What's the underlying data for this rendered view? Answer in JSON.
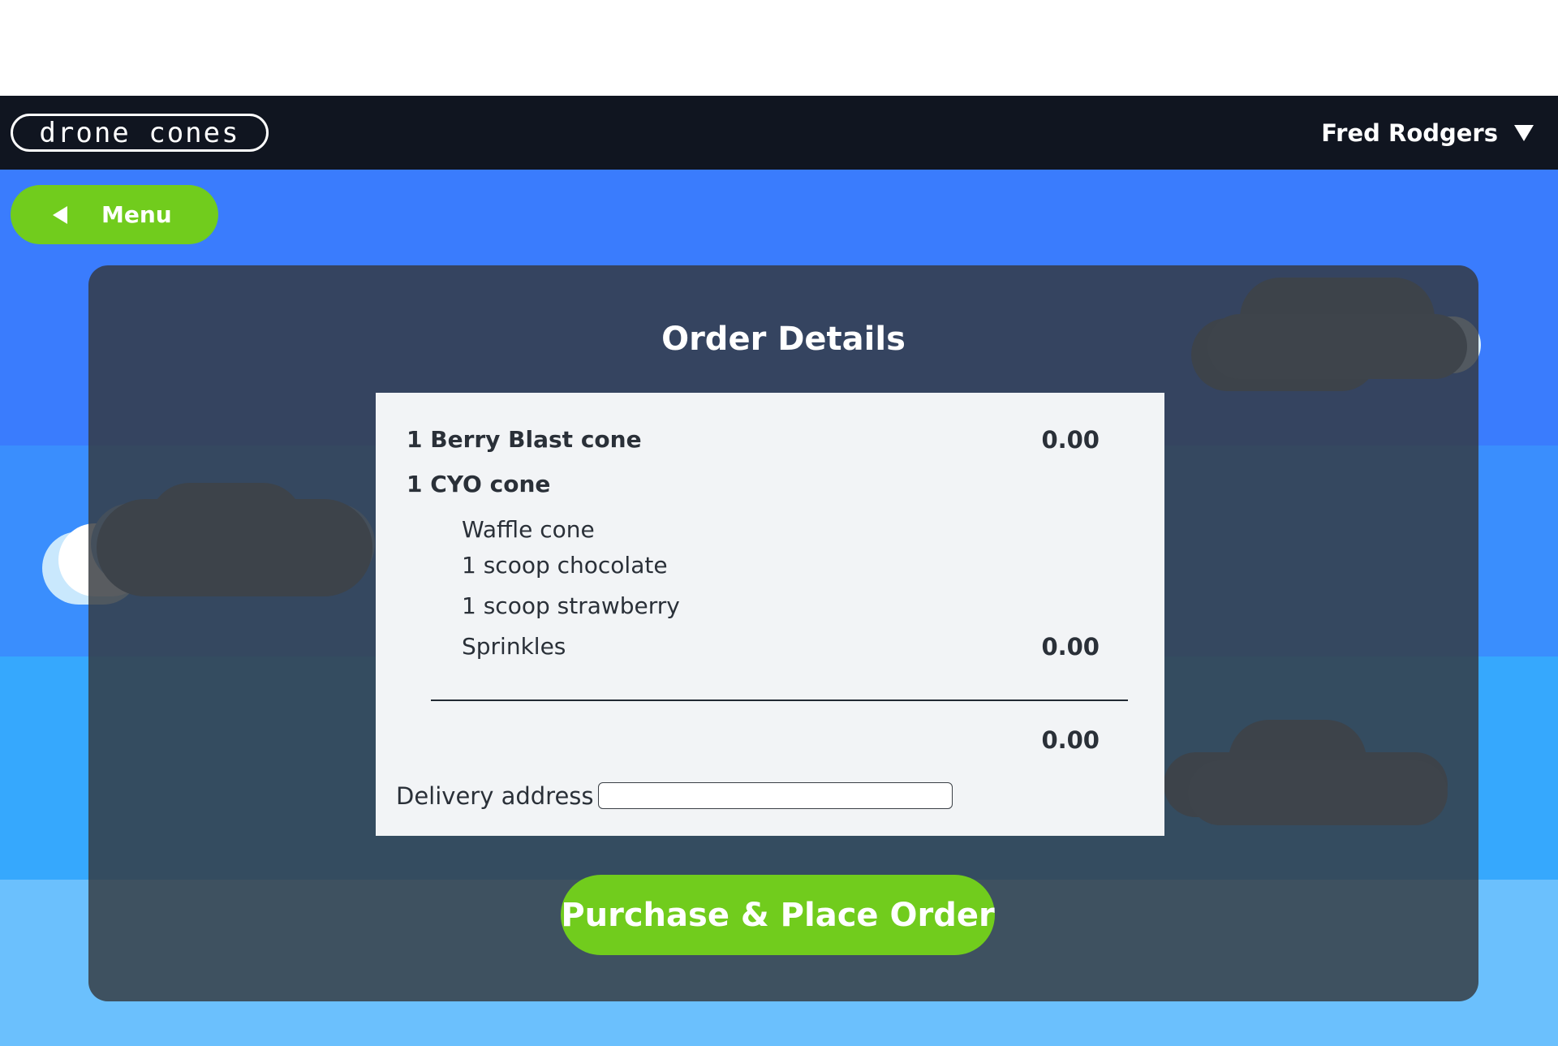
{
  "navbar": {
    "logo_text": "drone cones",
    "user_name": "Fred Rodgers"
  },
  "back_button": {
    "label": "Menu"
  },
  "order": {
    "title": "Order Details",
    "items": [
      {
        "label": "1 Berry Blast cone",
        "price": "0.00"
      },
      {
        "label": "1 CYO cone"
      }
    ],
    "cyo_details": [
      "Waffle cone",
      "1 scoop chocolate",
      "1 scoop strawberry",
      "Sprinkles"
    ],
    "cyo_price": "0.00",
    "total": "0.00",
    "delivery_label": "Delivery address",
    "delivery_value": ""
  },
  "purchase_button": {
    "label": "Purchase & Place Order"
  },
  "colors": {
    "navbar": "#101520",
    "accent_green": "#71cc1d",
    "sky_top": "#3a7cfd",
    "panel": "#34383d"
  },
  "icons": {
    "user_menu": "caret-down-icon",
    "back": "arrow-left-icon"
  }
}
